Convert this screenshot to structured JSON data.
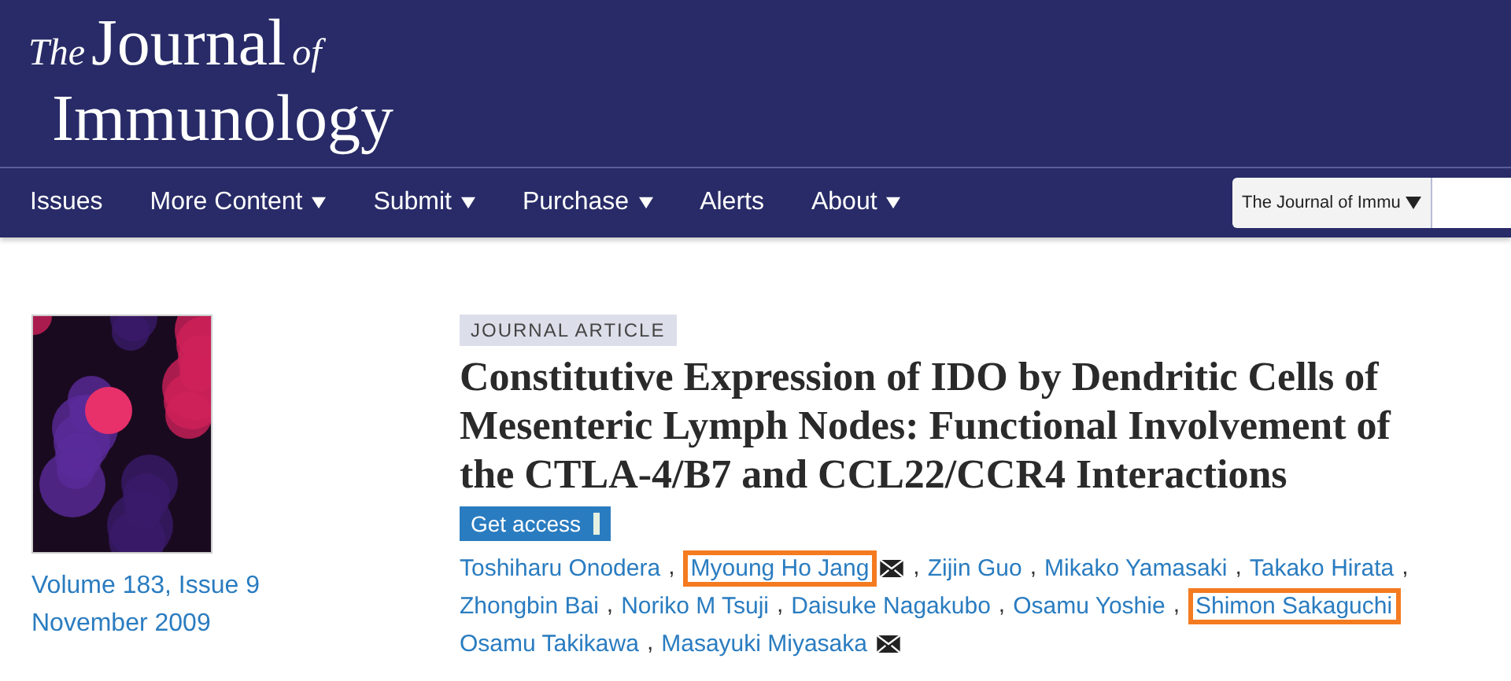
{
  "logo": {
    "the": "The",
    "journal": "Journal",
    "of": "of",
    "name": "Immunology"
  },
  "nav": [
    {
      "label": "Issues",
      "dropdown": false
    },
    {
      "label": "More Content",
      "dropdown": true
    },
    {
      "label": "Submit",
      "dropdown": true
    },
    {
      "label": "Purchase",
      "dropdown": true
    },
    {
      "label": "Alerts",
      "dropdown": false
    },
    {
      "label": "About",
      "dropdown": true
    }
  ],
  "search": {
    "scope": "The Journal of Immu"
  },
  "issue": {
    "volume": "Volume 183, Issue 9",
    "date": "November 2009"
  },
  "article": {
    "type": "JOURNAL ARTICLE",
    "title": "Constitutive Expression of IDO by Dendritic Cells of Mesenteric Lymph Nodes: Functional Involvement of the CTLA-4/B7 and CCL22/CCR4 Interactions",
    "access_button": "Get access",
    "author_lines": [
      [
        {
          "name": "Toshiharu Onodera",
          "highlighted": false,
          "email": false,
          "separator": ","
        },
        {
          "name": "Myoung Ho Jang",
          "highlighted": true,
          "email": true,
          "separator": ","
        },
        {
          "name": "Zijin Guo",
          "highlighted": false,
          "email": false,
          "separator": ","
        },
        {
          "name": "Mikako Yamasaki",
          "highlighted": false,
          "email": false,
          "separator": ","
        },
        {
          "name": "Takako Hirata",
          "highlighted": false,
          "email": false,
          "separator": ","
        }
      ],
      [
        {
          "name": "Zhongbin Bai",
          "highlighted": false,
          "email": false,
          "separator": ","
        },
        {
          "name": "Noriko M Tsuji",
          "highlighted": false,
          "email": false,
          "separator": ","
        },
        {
          "name": "Daisuke Nagakubo",
          "highlighted": false,
          "email": false,
          "separator": ","
        },
        {
          "name": "Osamu Yoshie",
          "highlighted": false,
          "email": false,
          "separator": ","
        },
        {
          "name": "Shimon Sakaguchi",
          "highlighted": true,
          "email": false
        }
      ],
      [
        {
          "name": "Osamu Takikawa",
          "highlighted": false,
          "email": false,
          "separator": ","
        },
        {
          "name": "Masayuki Miyasaka",
          "highlighted": false,
          "email": true
        }
      ]
    ]
  }
}
